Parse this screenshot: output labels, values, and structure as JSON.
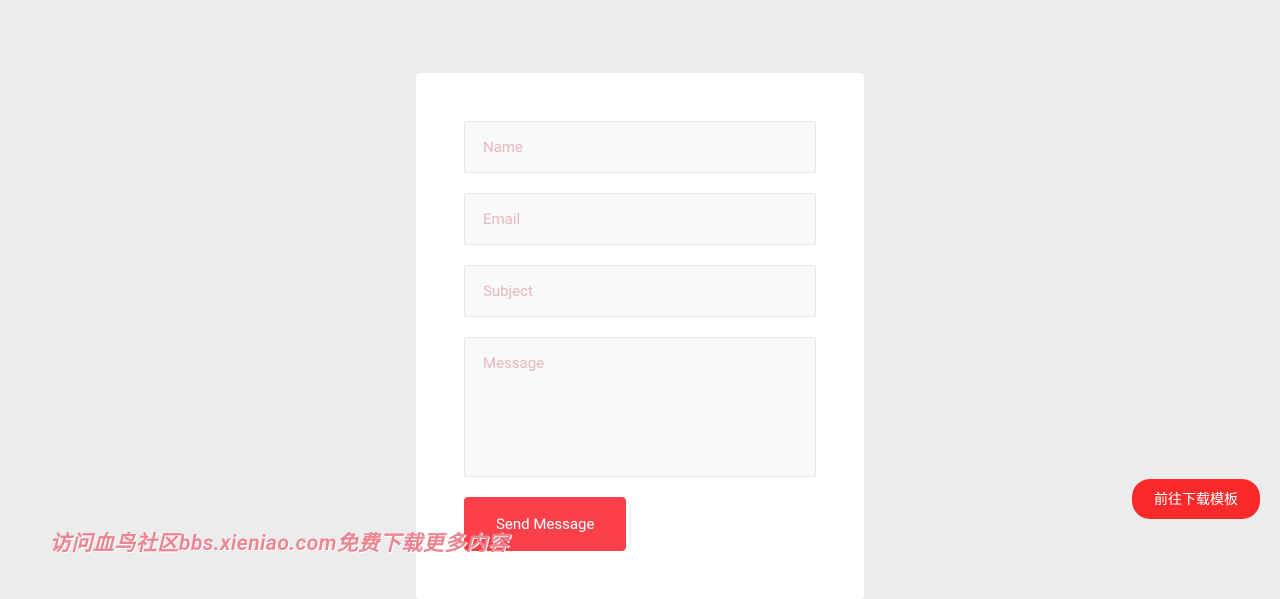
{
  "form": {
    "name_placeholder": "Name",
    "email_placeholder": "Email",
    "subject_placeholder": "Subject",
    "message_placeholder": "Message",
    "submit_label": "Send Message"
  },
  "download_button_label": "前往下载模板",
  "watermark_text": "访问血鸟社区bbs.xieniao.com免费下载更多内容"
}
